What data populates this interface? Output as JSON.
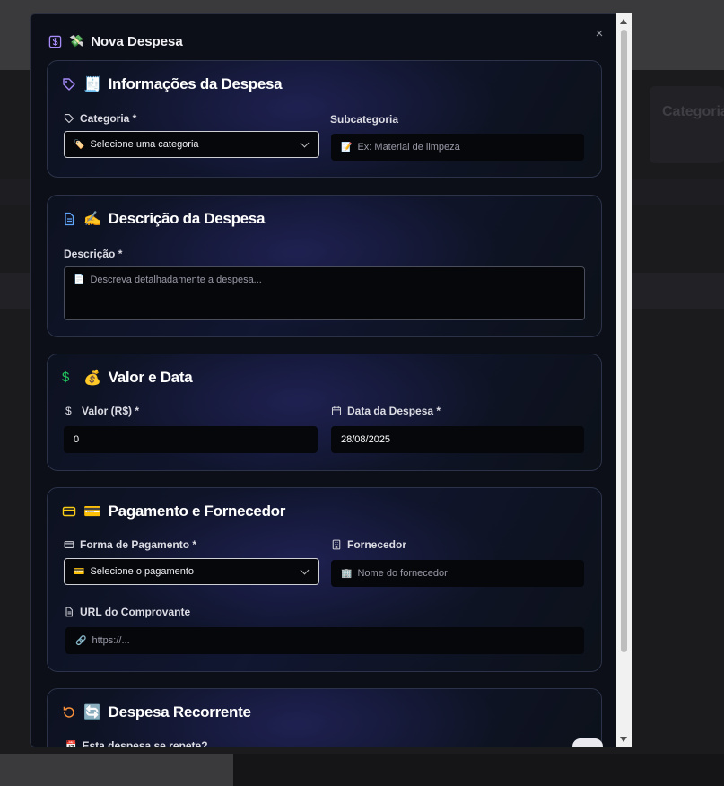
{
  "backdrop": {
    "card_label": "Categoria"
  },
  "modal": {
    "title": "Nova Despesa",
    "title_emoji": "💸",
    "close": "×"
  },
  "sections": {
    "info": {
      "title": "Informações da Despesa",
      "emoji": "🧾",
      "categoria_label": "Categoria *",
      "categoria_value": "Selecione uma categoria",
      "categoria_emoji": "🏷️",
      "subcategoria_label": "Subcategoria",
      "subcategoria_placeholder": "Ex: Material de limpeza",
      "subcategoria_emoji": "📝"
    },
    "descricao": {
      "title": "Descrição da Despesa",
      "emoji": "✍️",
      "label": "Descrição *",
      "placeholder": "Descreva detalhadamente a despesa...",
      "placeholder_emoji": "📄"
    },
    "valor": {
      "title": "Valor e Data",
      "emoji": "💰",
      "valor_label": "Valor (R$) *",
      "valor_value": "0",
      "data_label": "Data da Despesa *",
      "data_value": "28/08/2025"
    },
    "pagamento": {
      "title": "Pagamento e Fornecedor",
      "emoji": "💳",
      "forma_label": "Forma de Pagamento *",
      "forma_value": "Selecione o pagamento",
      "forma_emoji": "💳",
      "fornecedor_label": "Fornecedor",
      "fornecedor_placeholder": "Nome do fornecedor",
      "fornecedor_emoji": "🏢",
      "url_label": "URL do Comprovante",
      "url_placeholder": "https://...",
      "url_emoji": "🔗"
    },
    "recorrente": {
      "title": "Despesa Recorrente",
      "emoji": "🔄",
      "question": "Esta despesa se repete?",
      "question_emoji": "📅"
    }
  },
  "colors": {
    "tag_icon": "#a78bfa",
    "doc_icon": "#60a5fa",
    "dollar_icon": "#22c55e",
    "card_icon": "#facc15",
    "refresh_icon": "#fb923c",
    "title_icon": "#a78bfa"
  }
}
